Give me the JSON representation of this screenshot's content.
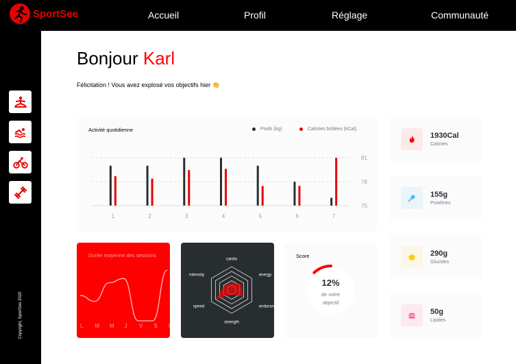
{
  "brand": {
    "name": "SportSee",
    "color": "#e60000"
  },
  "nav": {
    "items": [
      "Accueil",
      "Profil",
      "Réglage",
      "Communauté"
    ]
  },
  "sidebar": {
    "items": [
      {
        "icon": "yoga-icon"
      },
      {
        "icon": "swimming-icon"
      },
      {
        "icon": "cycling-icon"
      },
      {
        "icon": "dumbbell-icon"
      }
    ],
    "copyright": "Copyright, SportSee 2020"
  },
  "greeting": {
    "prefix": "Bonjour",
    "name": "Karl",
    "message": "Félicitation ! Vous avez explosé vos objectifs hier",
    "emoji": "👏"
  },
  "chart_data": [
    {
      "type": "bar",
      "title": "Activité quotidienne",
      "categories": [
        "1",
        "2",
        "3",
        "4",
        "5",
        "6",
        "7"
      ],
      "series": [
        {
          "name": "Poids (kg)",
          "color": "#282d30",
          "values": [
            80,
            80,
            81,
            81,
            80,
            78,
            76
          ]
        },
        {
          "name": "Calories brûlées (kCal)",
          "color": "#e60000",
          "values": [
            240,
            220,
            290,
            300,
            160,
            162,
            390
          ]
        }
      ],
      "y_ticks": [
        "81",
        "78",
        "75"
      ],
      "ylim": [
        75,
        81
      ],
      "legend": "top-right",
      "grid": "horizontal dashed"
    },
    {
      "type": "line",
      "title": "Durée moyenne des sessions",
      "categories": [
        "L",
        "M",
        "M",
        "J",
        "V",
        "S",
        "D"
      ],
      "values": [
        30,
        23,
        45,
        50,
        0,
        0,
        60
      ],
      "color": "#ffffff"
    },
    {
      "type": "radar",
      "categories": [
        "intensity",
        "speed",
        "strength",
        "endurance",
        "energy",
        "cardio"
      ],
      "values": [
        90,
        200,
        50,
        140,
        120,
        80
      ],
      "max": 250,
      "color": "#ff0101"
    },
    {
      "type": "pie",
      "title": "Score",
      "value": 0.12,
      "display": "12%",
      "label_line1": "de votre",
      "label_line2": "objectif",
      "color": "#ff0000"
    }
  ],
  "kpis": [
    {
      "value": "1930Cal",
      "label": "Calories",
      "icon": "flame-icon",
      "bg": "#fbeaea",
      "color": "#ff0000"
    },
    {
      "value": "155g",
      "label": "Protéines",
      "icon": "chicken-icon",
      "bg": "#e9f4fb",
      "color": "#4ab8ff"
    },
    {
      "value": "290g",
      "label": "Glucides",
      "icon": "apple-icon",
      "bg": "#fbf6e5",
      "color": "#fdcc0c"
    },
    {
      "value": "50g",
      "label": "Lipides",
      "icon": "burger-icon",
      "bg": "#fbeaef",
      "color": "#fd5181"
    }
  ]
}
